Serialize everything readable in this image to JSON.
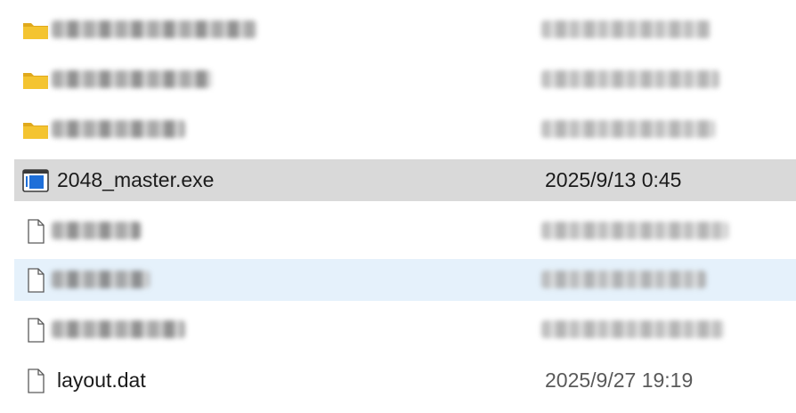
{
  "files": [
    {
      "kind": "folder",
      "name": "",
      "date": "",
      "obscured": true,
      "state": "normal"
    },
    {
      "kind": "folder",
      "name": "",
      "date": "",
      "obscured": true,
      "state": "normal"
    },
    {
      "kind": "folder",
      "name": "",
      "date": "",
      "obscured": true,
      "state": "normal"
    },
    {
      "kind": "exe",
      "name": "2048_master.exe",
      "date": "2025/9/13 0:45",
      "obscured": false,
      "state": "selected"
    },
    {
      "kind": "file",
      "name": "",
      "date": "",
      "obscured": true,
      "state": "normal"
    },
    {
      "kind": "file",
      "name": "",
      "date": "",
      "obscured": true,
      "state": "hovered"
    },
    {
      "kind": "file",
      "name": "",
      "date": "",
      "obscured": true,
      "state": "normal"
    },
    {
      "kind": "file",
      "name": "layout.dat",
      "date": "2025/9/27 19:19",
      "obscured": false,
      "state": "normal"
    }
  ],
  "colors": {
    "folder": "#f4c430",
    "selected_row": "#d9d9d9",
    "hover_row": "#e5f1fb",
    "exe_accent": "#1e6fd9"
  },
  "icons": {
    "folder": "folder-icon",
    "exe": "application-icon",
    "file": "document-icon"
  }
}
